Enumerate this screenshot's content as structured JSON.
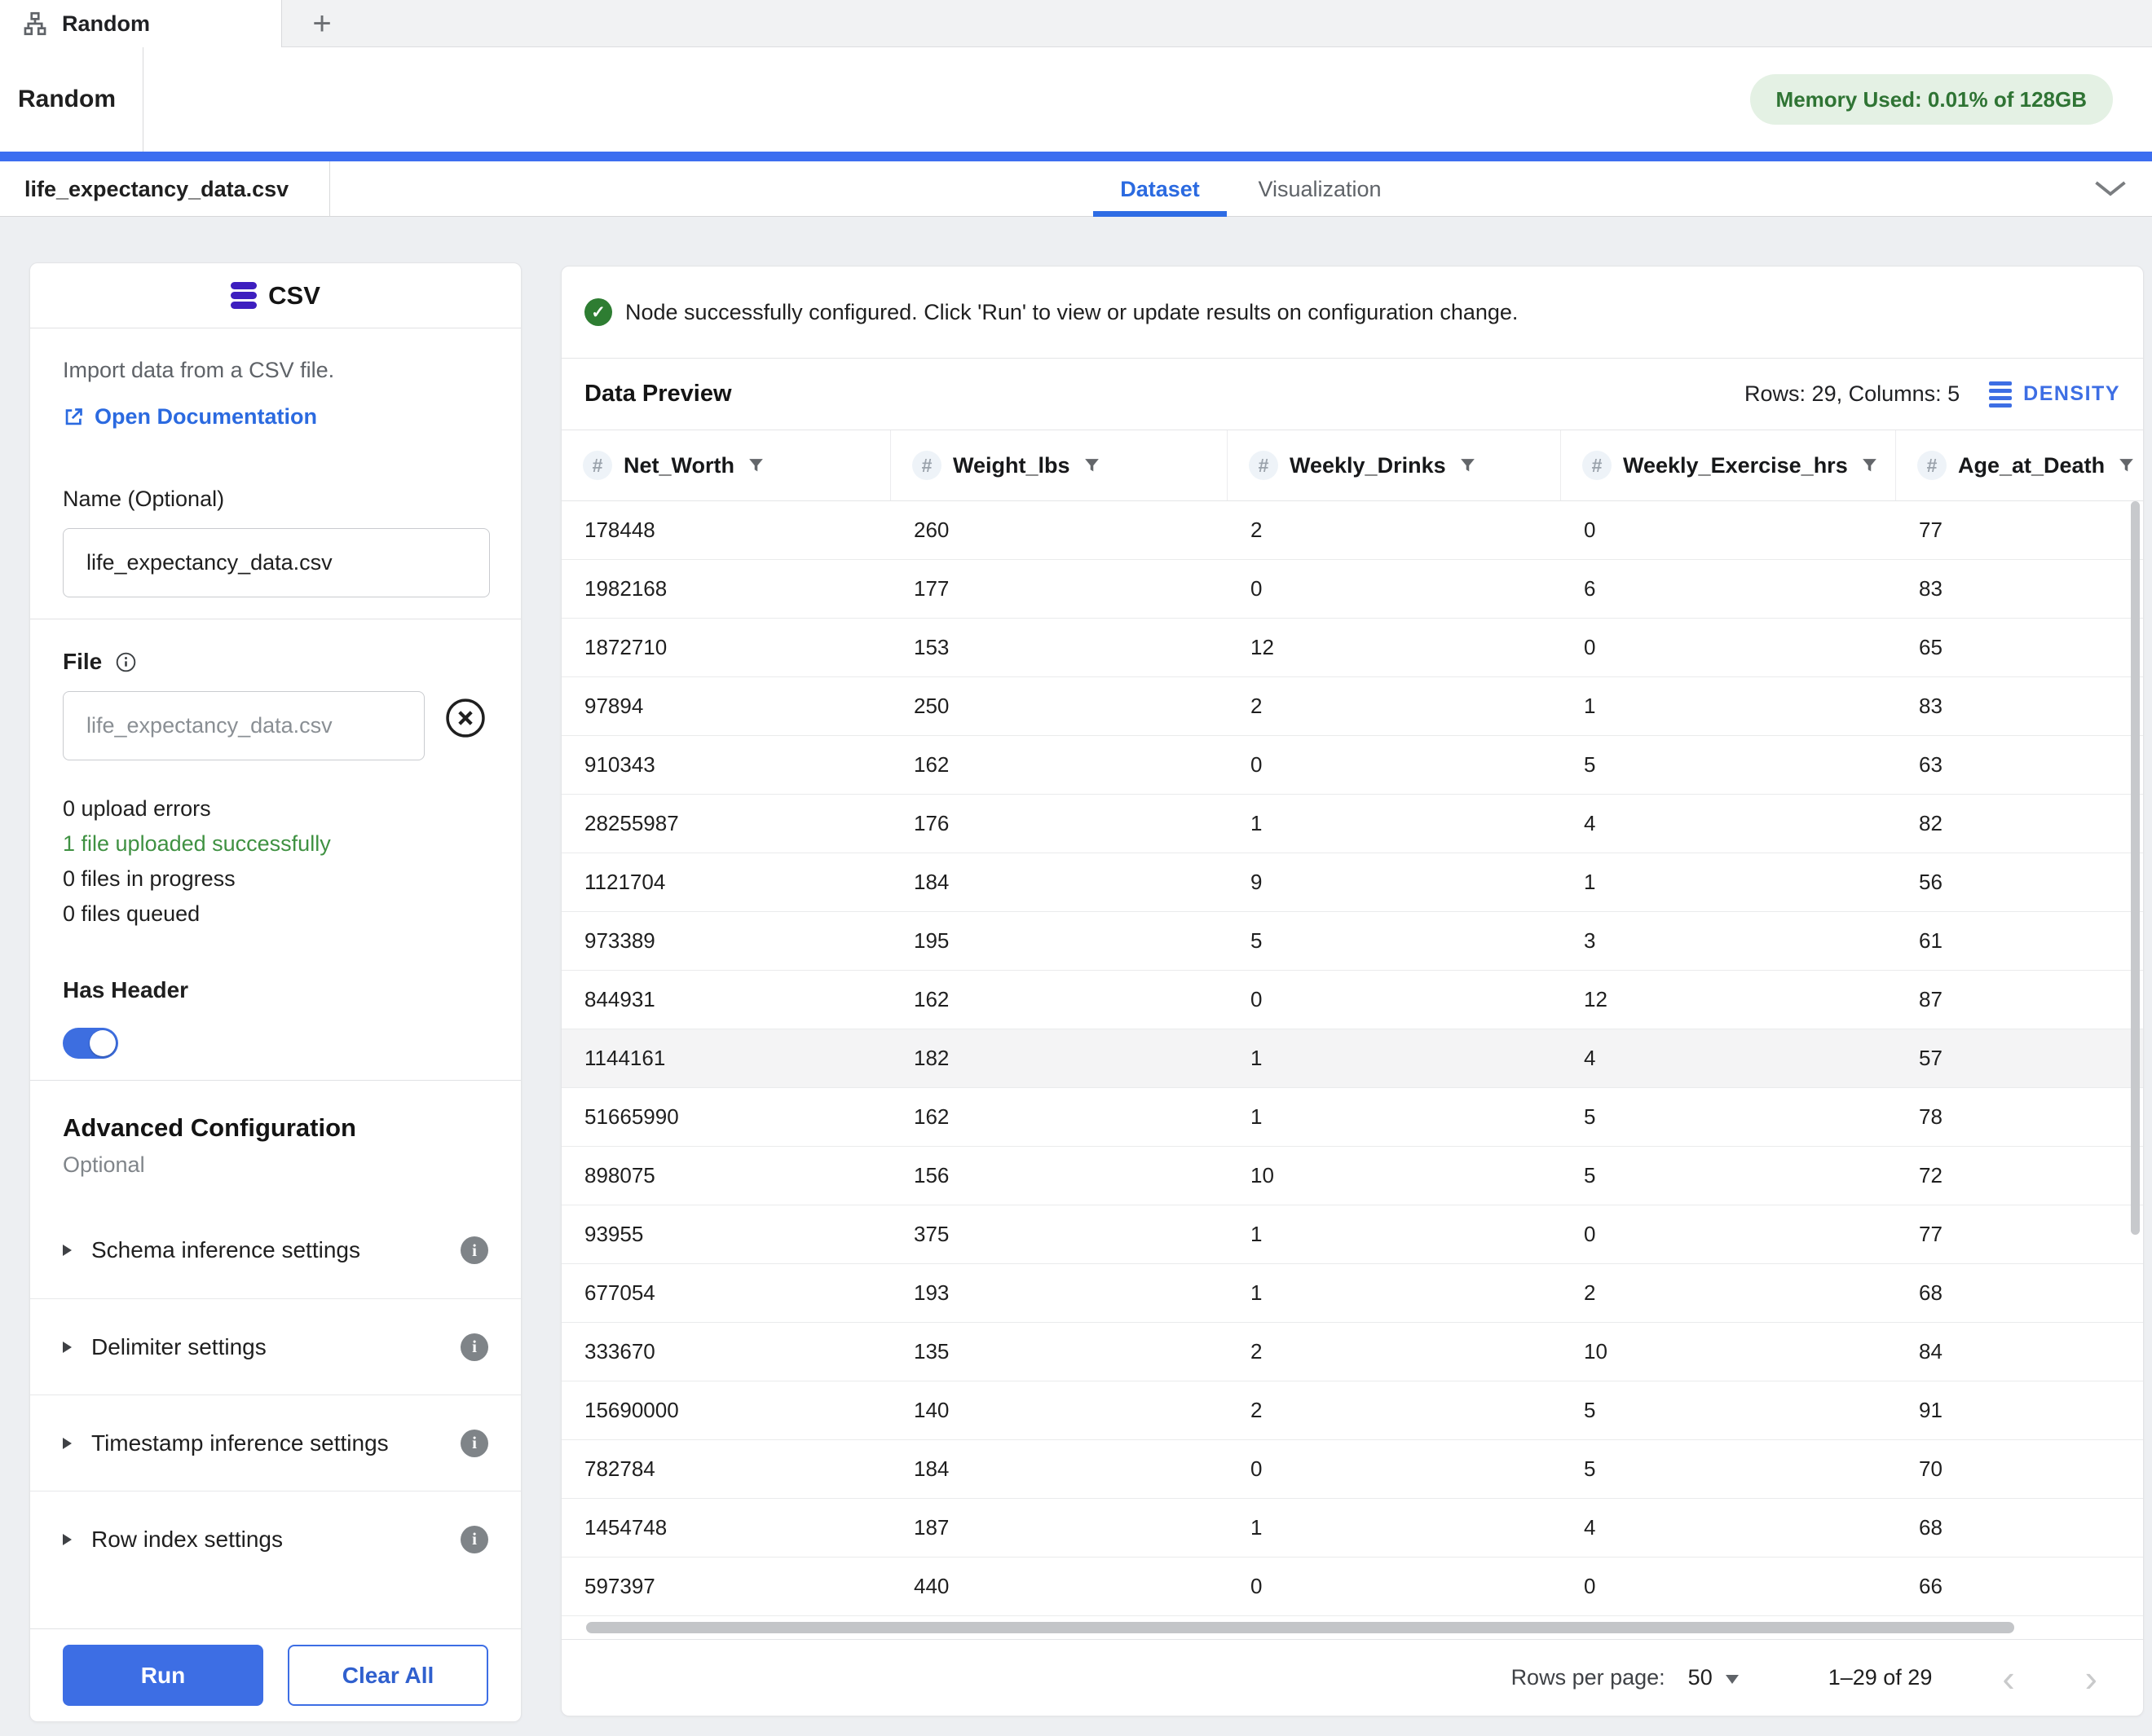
{
  "colors": {
    "accent_blue": "#3d6ee4",
    "topbar_blue": "#3c6ef0",
    "success_green": "#3f9142",
    "check_green": "#2e7d32",
    "memory_badge_bg": "#e4f1e4",
    "memory_badge_text": "#2f7434",
    "csv_icon_purple": "#3e1fbf"
  },
  "titlebar": {
    "tab_label": "Random",
    "new_tab_label": "+"
  },
  "header": {
    "title": "Random",
    "memory_badge": "Memory Used: 0.01% of 128GB"
  },
  "tabs": {
    "file_tab": "life_expectancy_data.csv",
    "dataset_label": "Dataset",
    "visualization_label": "Visualization"
  },
  "node_panel": {
    "type_label": "CSV",
    "description": "Import data from a CSV file.",
    "doc_link": "Open Documentation",
    "name_label": "Name (Optional)",
    "name_value": "life_expectancy_data.csv",
    "file_label": "File",
    "file_value": "life_expectancy_data.csv",
    "upload_status": [
      {
        "text": "0 upload errors",
        "green": false
      },
      {
        "text": "1 file uploaded successfully",
        "green": true
      },
      {
        "text": "0 files in progress",
        "green": false
      },
      {
        "text": "0 files queued",
        "green": false
      }
    ],
    "has_header_label": "Has Header",
    "has_header_on": true,
    "advanced": {
      "title": "Advanced Configuration",
      "subtitle": "Optional",
      "sections": [
        "Schema inference settings",
        "Delimiter settings",
        "Timestamp inference settings",
        "Row index settings"
      ]
    },
    "run_label": "Run",
    "clear_label": "Clear All"
  },
  "results": {
    "status_message": "Node successfully configured. Click 'Run' to view or update results on configuration change.",
    "preview_title": "Data Preview",
    "meta": "Rows: 29, Columns: 5",
    "density_label": "DENSITY",
    "footer": {
      "rows_per_page_label": "Rows per page:",
      "rows_per_page_value": "50",
      "range_label": "1–29 of 29"
    }
  },
  "table": {
    "columns": [
      "Net_Worth",
      "Weight_lbs",
      "Weekly_Drinks",
      "Weekly_Exercise_hrs",
      "Age_at_Death"
    ],
    "highlighted_row_index": 9,
    "rows": [
      [
        178448,
        260,
        2,
        0,
        77
      ],
      [
        1982168,
        177,
        0,
        6,
        83
      ],
      [
        1872710,
        153,
        12,
        0,
        65
      ],
      [
        97894,
        250,
        2,
        1,
        83
      ],
      [
        910343,
        162,
        0,
        5,
        63
      ],
      [
        28255987,
        176,
        1,
        4,
        82
      ],
      [
        1121704,
        184,
        9,
        1,
        56
      ],
      [
        973389,
        195,
        5,
        3,
        61
      ],
      [
        844931,
        162,
        0,
        12,
        87
      ],
      [
        1144161,
        182,
        1,
        4,
        57
      ],
      [
        51665990,
        162,
        1,
        5,
        78
      ],
      [
        898075,
        156,
        10,
        5,
        72
      ],
      [
        93955,
        375,
        1,
        0,
        77
      ],
      [
        677054,
        193,
        1,
        2,
        68
      ],
      [
        333670,
        135,
        2,
        10,
        84
      ],
      [
        15690000,
        140,
        2,
        5,
        91
      ],
      [
        782784,
        184,
        0,
        5,
        70
      ],
      [
        1454748,
        187,
        1,
        4,
        68
      ],
      [
        597397,
        440,
        0,
        0,
        66
      ]
    ]
  }
}
